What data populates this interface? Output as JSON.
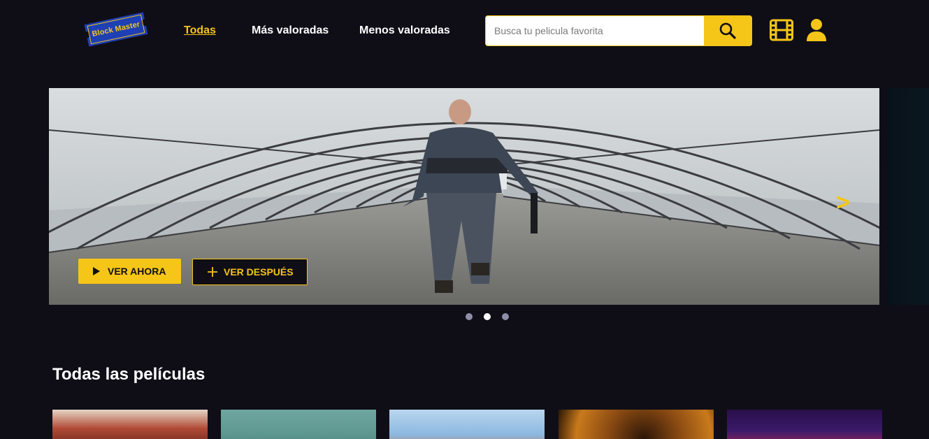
{
  "header": {
    "logo_text": "Block Master",
    "nav": [
      {
        "label": "Todas",
        "active": true
      },
      {
        "label": "Más valoradas",
        "active": false
      },
      {
        "label": "Menos valoradas",
        "active": false
      }
    ],
    "search": {
      "placeholder": "Busca tu pelicula favorita",
      "value": "",
      "icon": "search-icon"
    },
    "icons": [
      "film-icon",
      "user-icon"
    ]
  },
  "hero": {
    "buttons": {
      "watch_now": "VER AHORA",
      "watch_later": "VER DESPUÉS"
    },
    "next_arrow": ">",
    "dots": {
      "count": 3,
      "active_index": 1
    }
  },
  "section": {
    "title": "Todas las películas"
  },
  "colors": {
    "background": "#0f0e17",
    "accent": "#f5c518",
    "logo_blue": "#1f3fb4"
  }
}
